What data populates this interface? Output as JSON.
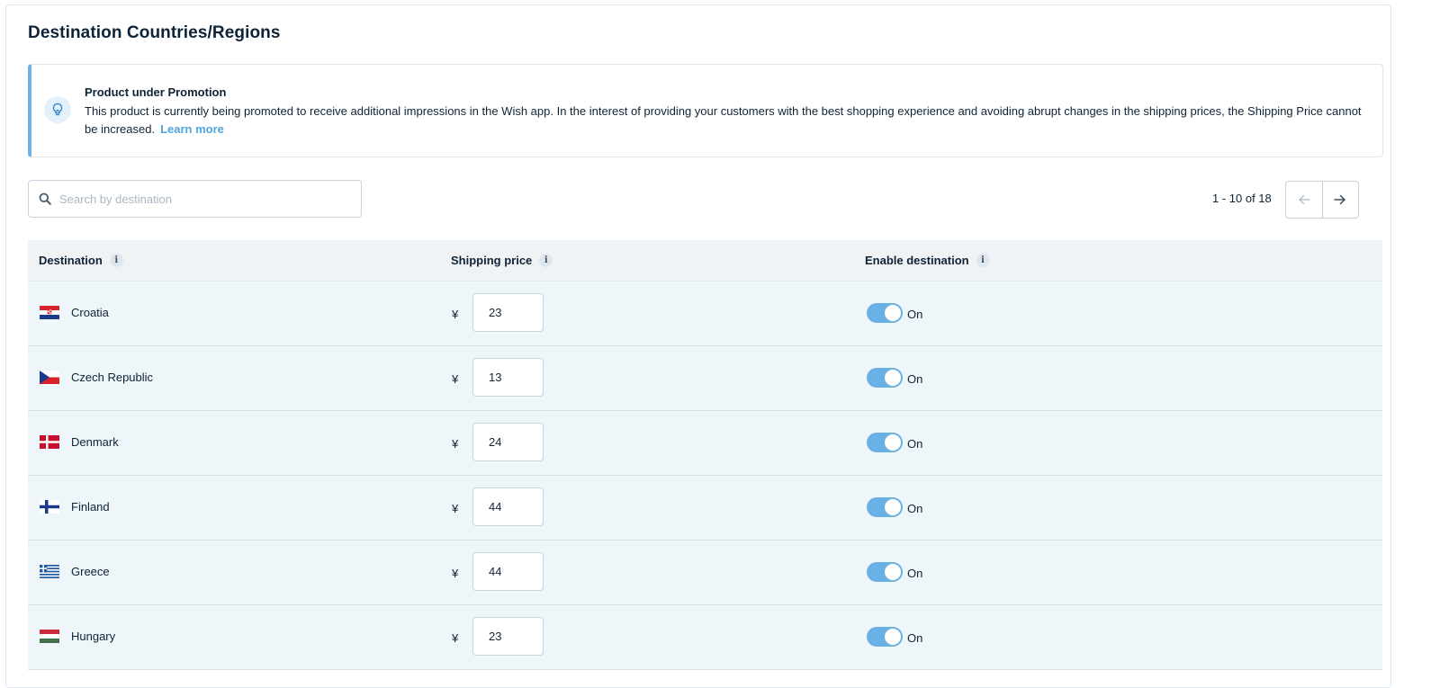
{
  "page": {
    "title": "Destination Countries/Regions"
  },
  "alert": {
    "title": "Product under Promotion",
    "body": "This product is currently being promoted to receive additional impressions in the Wish app. In the interest of providing your customers with the best shopping experience and avoiding abrupt changes in the shipping prices, the Shipping Price cannot be increased.",
    "link": "Learn more",
    "icon": "lightbulb-icon",
    "accent": "#6fb2e3"
  },
  "search": {
    "placeholder": "Search by destination",
    "value": ""
  },
  "pagination": {
    "label": "1 - 10 of 18"
  },
  "table": {
    "headers": {
      "destination": "Destination",
      "shipping_price": "Shipping price",
      "enable_destination": "Enable destination",
      "info": "i"
    },
    "rows": [
      {
        "country": "Croatia",
        "flag": "croatia",
        "currency": "¥",
        "price": "23",
        "enabled": true,
        "status": "On"
      },
      {
        "country": "Czech Republic",
        "flag": "czech",
        "currency": "¥",
        "price": "13",
        "enabled": true,
        "status": "On"
      },
      {
        "country": "Denmark",
        "flag": "denmark",
        "currency": "¥",
        "price": "24",
        "enabled": true,
        "status": "On"
      },
      {
        "country": "Finland",
        "flag": "finland",
        "currency": "¥",
        "price": "44",
        "enabled": true,
        "status": "On"
      },
      {
        "country": "Greece",
        "flag": "greece",
        "currency": "¥",
        "price": "44",
        "enabled": true,
        "status": "On"
      },
      {
        "country": "Hungary",
        "flag": "hungary",
        "currency": "¥",
        "price": "23",
        "enabled": true,
        "status": "On"
      }
    ]
  },
  "colors": {
    "toggle_on": "#6ab1e3",
    "row_bg": "#eef6f9",
    "header_bg": "#f0f3f6",
    "link": "#4ea7dd"
  }
}
